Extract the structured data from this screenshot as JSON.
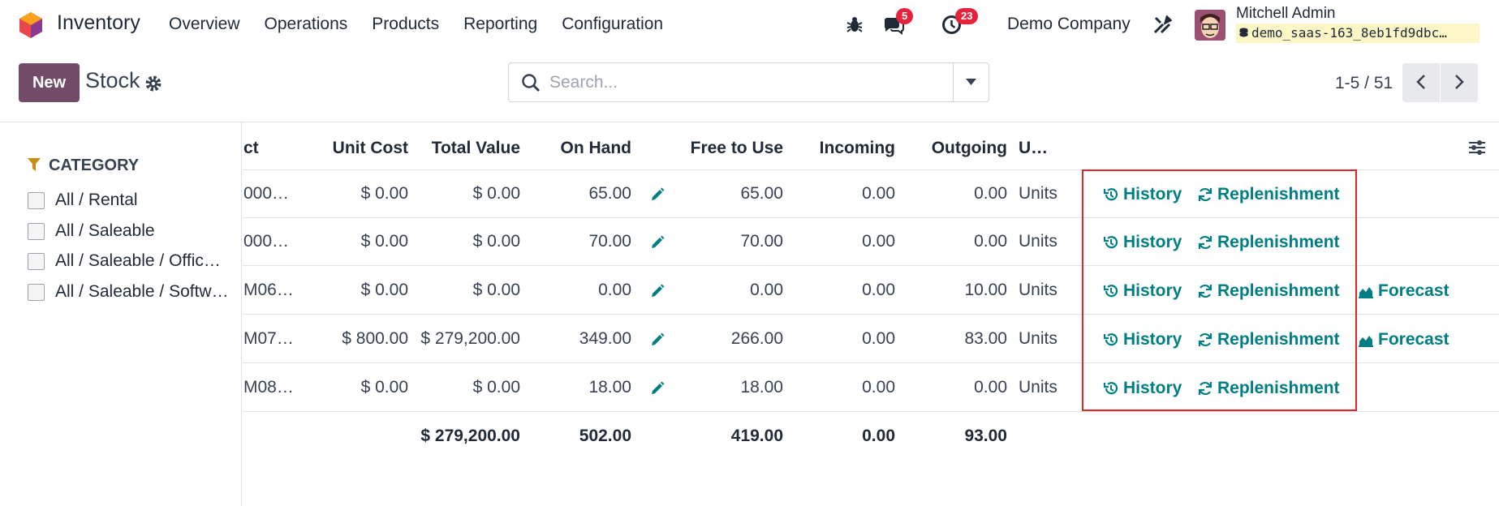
{
  "nav": {
    "app_name": "Inventory",
    "menu": [
      "Overview",
      "Operations",
      "Products",
      "Reporting",
      "Configuration"
    ],
    "messages_count": "5",
    "activities_count": "23",
    "company": "Demo Company",
    "user_name": "Mitchell Admin",
    "database": "demo_saas-163_8eb1fd9dbc…"
  },
  "control": {
    "new_label": "New",
    "title": "Stock",
    "search_placeholder": "Search...",
    "pager": "1-5 / 51"
  },
  "sidebar": {
    "heading": "CATEGORY",
    "items": [
      "All / Rental",
      "All / Saleable",
      "All / Saleable / Offic…",
      "All / Saleable / Softw…"
    ]
  },
  "table": {
    "headers": {
      "product": "ct",
      "unit_cost": "Unit Cost",
      "total_value": "Total Value",
      "on_hand": "On Hand",
      "free_to_use": "Free to Use",
      "incoming": "Incoming",
      "outgoing": "Outgoing",
      "uom": "U…"
    },
    "rows": [
      {
        "product": "000…",
        "unit_cost": "$ 0.00",
        "total_value": "$ 0.00",
        "on_hand": "65.00",
        "free": "65.00",
        "incoming": "0.00",
        "outgoing": "0.00",
        "uom": "Units",
        "history": "History",
        "replenish": "Replenishment",
        "forecast": ""
      },
      {
        "product": "000…",
        "unit_cost": "$ 0.00",
        "total_value": "$ 0.00",
        "on_hand": "70.00",
        "free": "70.00",
        "incoming": "0.00",
        "outgoing": "0.00",
        "uom": "Units",
        "history": "History",
        "replenish": "Replenishment",
        "forecast": ""
      },
      {
        "product": "M06…",
        "unit_cost": "$ 0.00",
        "total_value": "$ 0.00",
        "on_hand": "0.00",
        "free": "0.00",
        "incoming": "0.00",
        "outgoing": "10.00",
        "uom": "Units",
        "history": "History",
        "replenish": "Replenishment",
        "forecast": "Forecast"
      },
      {
        "product": "M07…",
        "unit_cost": "$ 800.00",
        "total_value": "$ 279,200.00",
        "on_hand": "349.00",
        "free": "266.00",
        "incoming": "0.00",
        "outgoing": "83.00",
        "uom": "Units",
        "history": "History",
        "replenish": "Replenishment",
        "forecast": "Forecast"
      },
      {
        "product": "M08…",
        "unit_cost": "$ 0.00",
        "total_value": "$ 0.00",
        "on_hand": "18.00",
        "free": "18.00",
        "incoming": "0.00",
        "outgoing": "0.00",
        "uom": "Units",
        "history": "History",
        "replenish": "Replenishment",
        "forecast": ""
      }
    ],
    "totals": {
      "total_value": "$ 279,200.00",
      "on_hand": "502.00",
      "free": "419.00",
      "incoming": "0.00",
      "outgoing": "93.00"
    }
  },
  "colors": {
    "brand": "#714b67",
    "action": "#017e84",
    "badge": "#e5243b",
    "highlight": "#e3242b"
  }
}
